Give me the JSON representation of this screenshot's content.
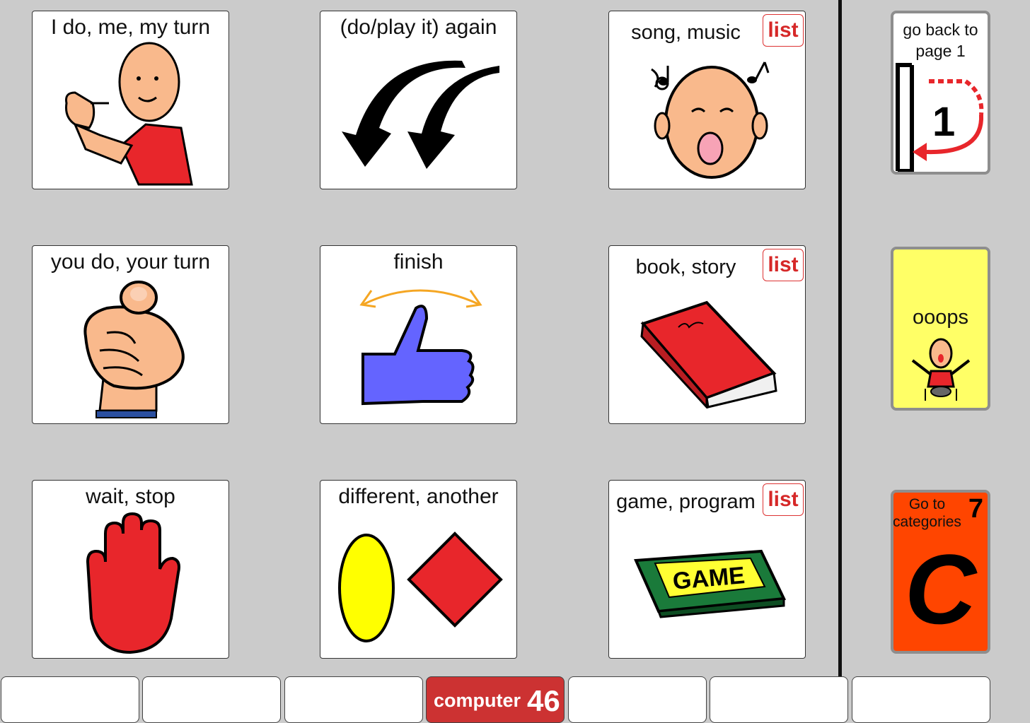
{
  "cards": [
    {
      "label": "I do, me, my turn"
    },
    {
      "label": "(do/play it) again"
    },
    {
      "label": "song, music",
      "badge": "list"
    },
    {
      "label": "you do, your turn"
    },
    {
      "label": "finish"
    },
    {
      "label": "book, story",
      "badge": "list"
    },
    {
      "label": "wait, stop"
    },
    {
      "label": "different, another"
    },
    {
      "label": "game, program",
      "badge": "list",
      "picture_text": "GAME"
    }
  ],
  "sidebar": {
    "back": {
      "line1": "go back to",
      "line2": "page 1",
      "number": "1"
    },
    "oops": {
      "label": "ooops"
    },
    "categories": {
      "line1": "Go to",
      "line2": "categories",
      "number": "7",
      "letter": "C"
    }
  },
  "bottom_bar": [
    {
      "label": "",
      "number": ""
    },
    {
      "label": "",
      "number": ""
    },
    {
      "label": "",
      "number": ""
    },
    {
      "label": "computer",
      "number": "46",
      "active": true
    },
    {
      "label": "",
      "number": ""
    },
    {
      "label": "",
      "number": ""
    },
    {
      "label": "",
      "number": ""
    }
  ],
  "colors": {
    "background": "#cbcbcb",
    "list_badge": "#d62828",
    "active_tab": "#cc3232",
    "oops_bg": "#ffff66",
    "categories_bg": "#ff4500"
  }
}
